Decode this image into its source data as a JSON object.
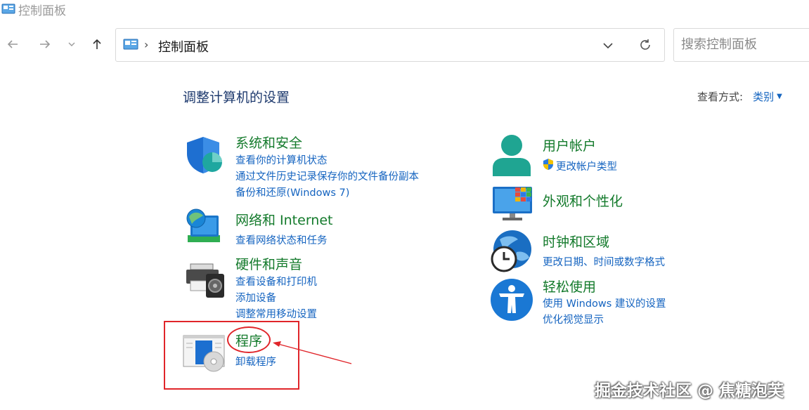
{
  "window": {
    "title": "控制面板",
    "icon": "control-panel-icon"
  },
  "nav": {
    "back": "back-arrow-icon",
    "forward": "forward-arrow-icon",
    "recent": "chevron-down-icon",
    "up": "up-arrow-icon"
  },
  "addressbar": {
    "crumb": "控制面板",
    "separator": "›"
  },
  "search": {
    "placeholder": "搜索控制面板"
  },
  "page": {
    "title": "调整计算机的设置",
    "viewby_label": "查看方式:",
    "viewby_value": "类别"
  },
  "categories": {
    "system_security": {
      "title": "系统和安全",
      "links": [
        "查看你的计算机状态",
        "通过文件历史记录保存你的文件备份副本",
        "备份和还原(Windows 7)"
      ]
    },
    "network": {
      "title": "网络和 Internet",
      "links": [
        "查看网络状态和任务"
      ]
    },
    "hardware": {
      "title": "硬件和声音",
      "links": [
        "查看设备和打印机",
        "添加设备",
        "调整常用移动设置"
      ]
    },
    "programs": {
      "title": "程序",
      "links": [
        "卸载程序"
      ]
    },
    "user_accounts": {
      "title": "用户帐户",
      "links": [
        "更改帐户类型"
      ]
    },
    "appearance": {
      "title": "外观和个性化",
      "links": []
    },
    "clock_region": {
      "title": "时钟和区域",
      "links": [
        "更改日期、时间或数字格式"
      ]
    },
    "ease_access": {
      "title": "轻松使用",
      "links": [
        "使用 Windows 建议的设置",
        "优化视觉显示"
      ]
    }
  },
  "watermark": "掘金技术社区 @ 焦糖泡芙",
  "colors": {
    "category_title": "#137a2b",
    "link": "#1564c0",
    "annotation": "#e0252a",
    "page_title": "#1e3a6e"
  }
}
